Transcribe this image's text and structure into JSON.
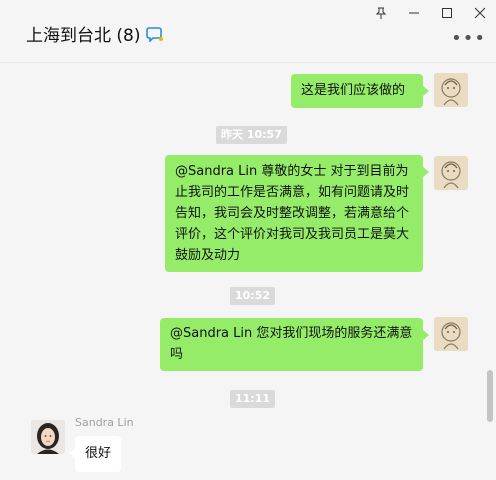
{
  "header": {
    "title": "上海到台北 (8)",
    "pin_icon": "pin-icon",
    "minimize_icon": "minimize-icon",
    "maximize_icon": "maximize-icon",
    "close_icon": "close-icon",
    "more_icon": "more-icon"
  },
  "messages": [
    {
      "type": "sent",
      "text": "这是我们应该做的"
    },
    {
      "type": "time",
      "text": "昨天 10:57"
    },
    {
      "type": "sent",
      "text": "@Sandra Lin  尊敬的女士 对于到目前为止我司的工作是否满意，如有问题请及时告知，我司会及时整改调整，若满意给个评价，这个评价对我司及我司员工是莫大鼓励及动力"
    },
    {
      "type": "time",
      "text": "10:52"
    },
    {
      "type": "sent",
      "text": "@Sandra Lin 您对我们现场的服务还满意吗"
    },
    {
      "type": "time",
      "text": "11:11"
    },
    {
      "type": "received",
      "sender": "Sandra Lin",
      "text": "很好"
    }
  ],
  "colors": {
    "bubble_sent": "#95ec69",
    "bubble_received": "#ffffff",
    "background": "#f5f5f5"
  }
}
